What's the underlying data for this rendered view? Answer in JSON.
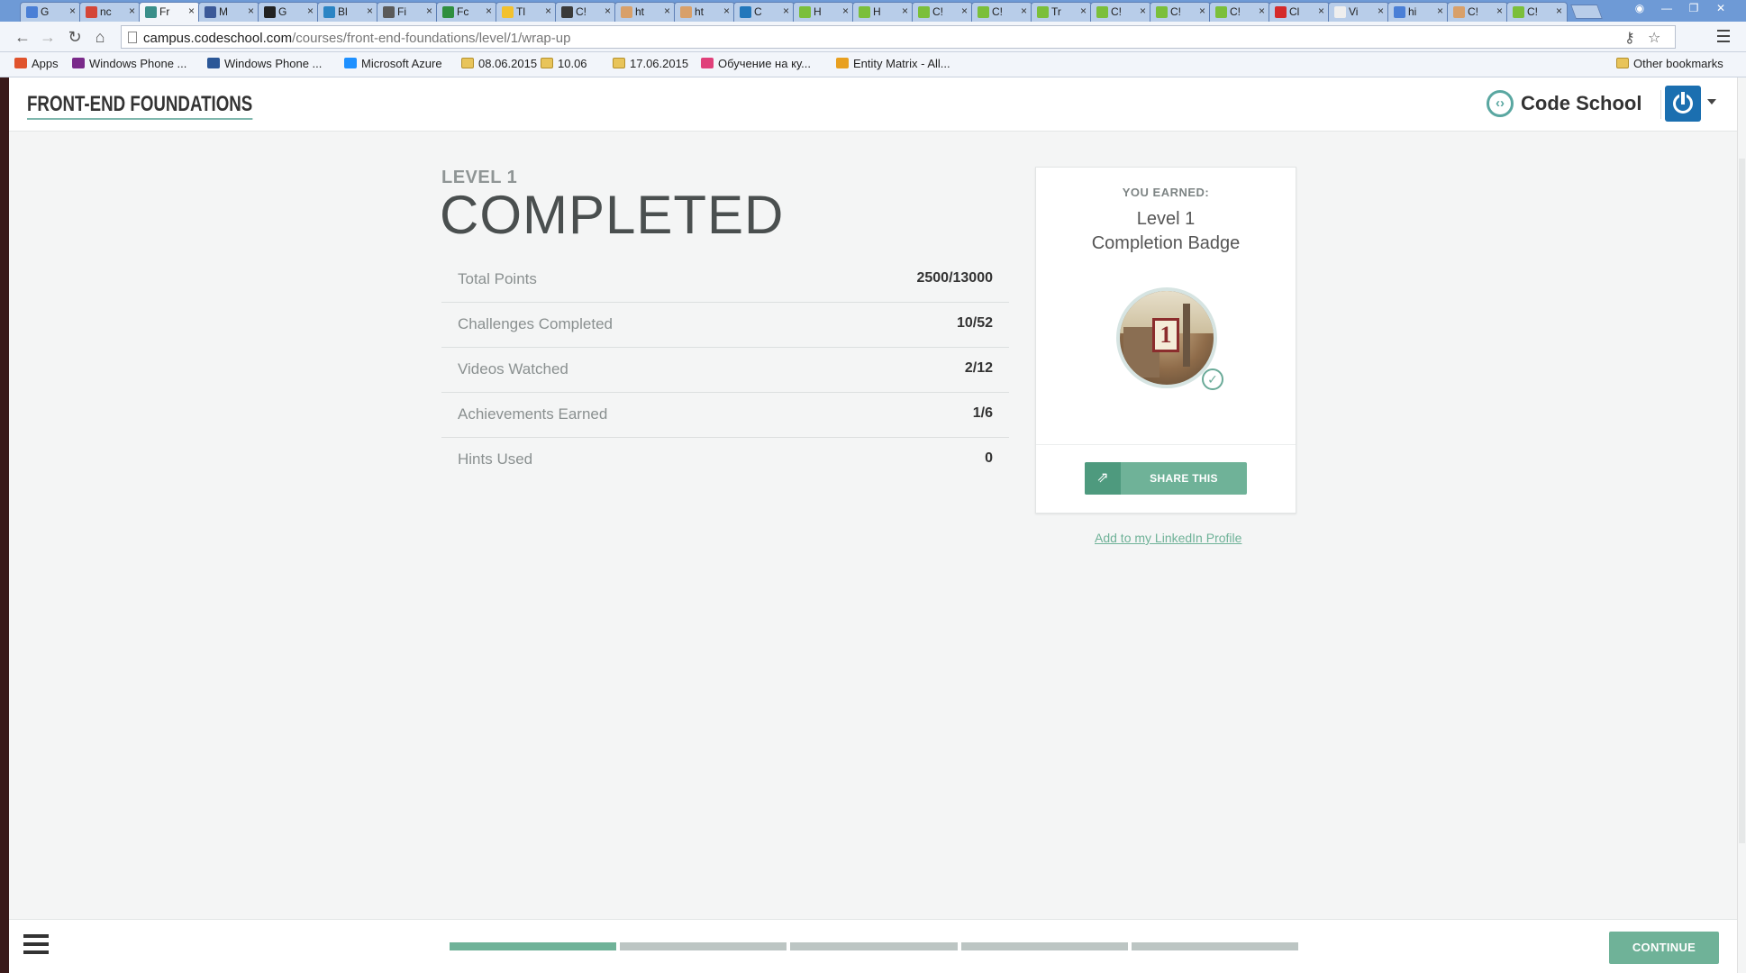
{
  "browser": {
    "tabs": [
      {
        "title": "G",
        "color": "#4a7fd6"
      },
      {
        "title": "nc",
        "color": "#d44638"
      },
      {
        "title": "Fr",
        "color": "#3a8f8a",
        "active": true
      },
      {
        "title": "M",
        "color": "#3b5998"
      },
      {
        "title": "G",
        "color": "#222222"
      },
      {
        "title": "Bl",
        "color": "#2a84c4"
      },
      {
        "title": "Fi",
        "color": "#5a5a5a"
      },
      {
        "title": "Fc",
        "color": "#2f8f3f"
      },
      {
        "title": "Tl",
        "color": "#f2c12e"
      },
      {
        "title": "C!",
        "color": "#3a3a3a"
      },
      {
        "title": "ht",
        "color": "#d8a06a"
      },
      {
        "title": "ht",
        "color": "#d8a06a"
      },
      {
        "title": "C",
        "color": "#2277bb"
      },
      {
        "title": "H",
        "color": "#7bbf3a"
      },
      {
        "title": "H",
        "color": "#7bbf3a"
      },
      {
        "title": "C!",
        "color": "#7bbf3a"
      },
      {
        "title": "C!",
        "color": "#7bbf3a"
      },
      {
        "title": "Tr",
        "color": "#7bbf3a"
      },
      {
        "title": "C!",
        "color": "#7bbf3a"
      },
      {
        "title": "C!",
        "color": "#7bbf3a"
      },
      {
        "title": "C!",
        "color": "#7bbf3a"
      },
      {
        "title": "Cl",
        "color": "#d42a2a"
      },
      {
        "title": "Vi",
        "color": "#eeeeee"
      },
      {
        "title": "hi",
        "color": "#4a7fd6"
      },
      {
        "title": "C!",
        "color": "#d8a06a"
      },
      {
        "title": "C!",
        "color": "#7bbf3a"
      }
    ],
    "url_host": "campus.codeschool.com",
    "url_path": "/courses/front-end-foundations/level/1/wrap-up",
    "bookmarks": [
      {
        "label": "Apps",
        "icon": "apps-grid-icon",
        "color": "#e0532d"
      },
      {
        "label": "Windows Phone ...",
        "icon": "windows-phone-icon",
        "color": "#7a2a8a"
      },
      {
        "label": "Windows Phone ...",
        "icon": "wp-icon",
        "color": "#2b5797"
      },
      {
        "label": "Microsoft Azure",
        "icon": "windows-logo-icon",
        "color": "#1e90ff"
      },
      {
        "label": "08.06.2015",
        "icon": "folder-icon",
        "color": "#e8c45a"
      },
      {
        "label": "10.06",
        "icon": "folder-icon",
        "color": "#e8c45a"
      },
      {
        "label": "17.06.2015",
        "icon": "folder-icon",
        "color": "#e8c45a"
      },
      {
        "label": "Обучение на ку...",
        "icon": "heart-icon",
        "color": "#e0407a"
      },
      {
        "label": "Entity Matrix - All...",
        "icon": "entity-icon",
        "color": "#e8a020"
      }
    ],
    "other_bookmarks": "Other bookmarks"
  },
  "header": {
    "course_title": "FRONT-END FOUNDATIONS",
    "brand": "Code School",
    "accent": "#5aa7a1",
    "avatar_color": "#1b6fb0"
  },
  "main": {
    "level_label": "LEVEL 1",
    "status_title": "COMPLETED",
    "stats": [
      {
        "label": "Total Points",
        "value": "2500/13000"
      },
      {
        "label": "Challenges Completed",
        "value": "10/52"
      },
      {
        "label": "Videos Watched",
        "value": "2/12"
      },
      {
        "label": "Achievements Earned",
        "value": "1/6"
      },
      {
        "label": "Hints Used",
        "value": "0"
      }
    ]
  },
  "badge_card": {
    "earned_label": "YOU EARNED:",
    "badge_line1": "Level 1",
    "badge_line2": "Completion Badge",
    "badge_number": "1",
    "share_label": "SHARE THIS",
    "linkedin_label": "Add to my LinkedIn Profile",
    "button_color": "#6fb298"
  },
  "footer": {
    "progress_total_segments": 5,
    "progress_completed_segments": 1,
    "continue_label": "CONTINUE"
  }
}
